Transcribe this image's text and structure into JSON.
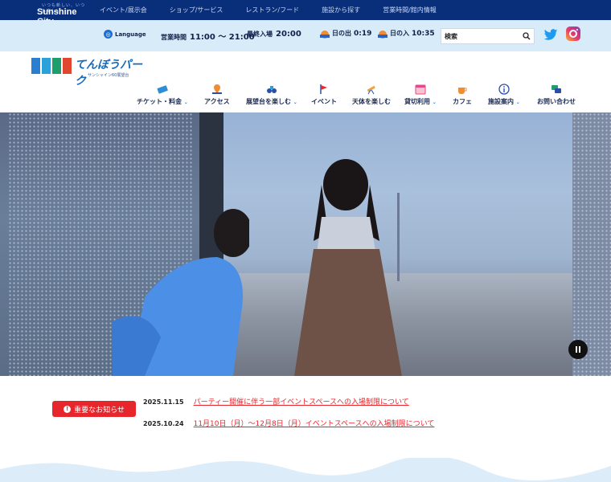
{
  "topbar": {
    "brand_small": "いつも新しい、いつも楽しい",
    "brand_name": "Sunshine City",
    "links": [
      "イベント/展示会",
      "ショップ/サービス",
      "レストラン/フード",
      "施設から探す",
      "営業時間/館内情報"
    ]
  },
  "infobar": {
    "language_label": "Language",
    "hours_label": "営業時間",
    "hours_value": "11:00 ～ 21:00",
    "last_entry_label": "最終入場",
    "last_entry_value": "20:00",
    "sunrise_label": "日の出",
    "sunrise_value": "0:19",
    "sunset_label": "日の入",
    "sunset_value": "10:35",
    "search_placeholder": "検索"
  },
  "logo": {
    "title": "てんぼうパーク",
    "subtitle": "サンシャイン60展望台",
    "block_colors": [
      "#2a7fd0",
      "#2aa1d8",
      "#1d9e6b",
      "#e0472e",
      "#2a4fa8"
    ]
  },
  "mainnav": [
    {
      "label": "チケット・料金",
      "icon": "ticket-icon",
      "dropdown": true
    },
    {
      "label": "アクセス",
      "icon": "map-pin-icon",
      "dropdown": false
    },
    {
      "label": "展望台を楽しむ",
      "icon": "binoculars-icon",
      "dropdown": true
    },
    {
      "label": "イベント",
      "icon": "flag-icon",
      "dropdown": false
    },
    {
      "label": "天体を楽しむ",
      "icon": "telescope-icon",
      "dropdown": false
    },
    {
      "label": "貸切利用",
      "icon": "calendar-icon",
      "dropdown": true
    },
    {
      "label": "カフェ",
      "icon": "cup-icon",
      "dropdown": false
    },
    {
      "label": "施設案内",
      "icon": "info-icon",
      "dropdown": true
    },
    {
      "label": "お問い合わせ",
      "icon": "chat-icon",
      "dropdown": false
    }
  ],
  "notice": {
    "button_label": "重要なお知らせ",
    "items": [
      {
        "date": "2025.11.15",
        "text": "パーティー開催に伴う一部イベントスペースへの入場制限について"
      },
      {
        "date": "2025.10.24",
        "text": "11月10日（月）～12月8日（月）イベントスペースへの入場制限について"
      }
    ]
  },
  "colors": {
    "topbar_bg": "#0a2f7a",
    "infobar_bg": "#d8ebf8",
    "accent_red": "#e7262b",
    "accent_blue": "#1a6fd6"
  }
}
